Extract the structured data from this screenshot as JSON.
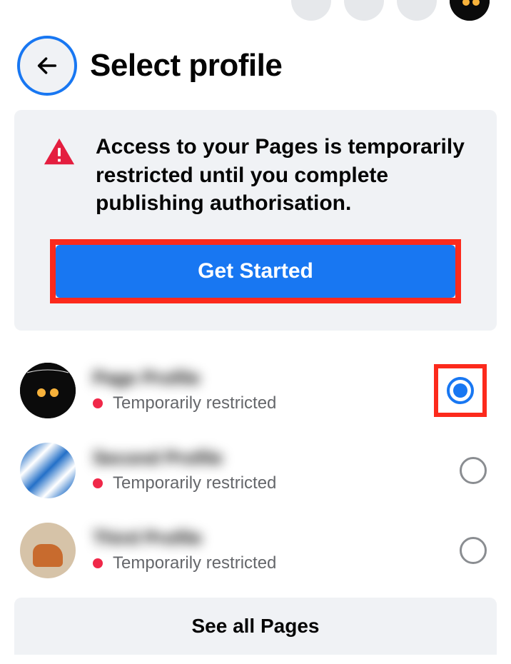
{
  "header": {
    "title": "Select profile"
  },
  "alert": {
    "message": "Access to your Pages is temporarily restricted until you complete publishing authorisation.",
    "button_label": "Get Started"
  },
  "profiles": [
    {
      "name": "Page Profile",
      "status": "Temporarily restricted",
      "selected": true
    },
    {
      "name": "Second Profile",
      "status": "Temporarily restricted",
      "selected": false
    },
    {
      "name": "Third Profile",
      "status": "Temporarily restricted",
      "selected": false
    }
  ],
  "footer": {
    "see_all_label": "See all Pages"
  }
}
